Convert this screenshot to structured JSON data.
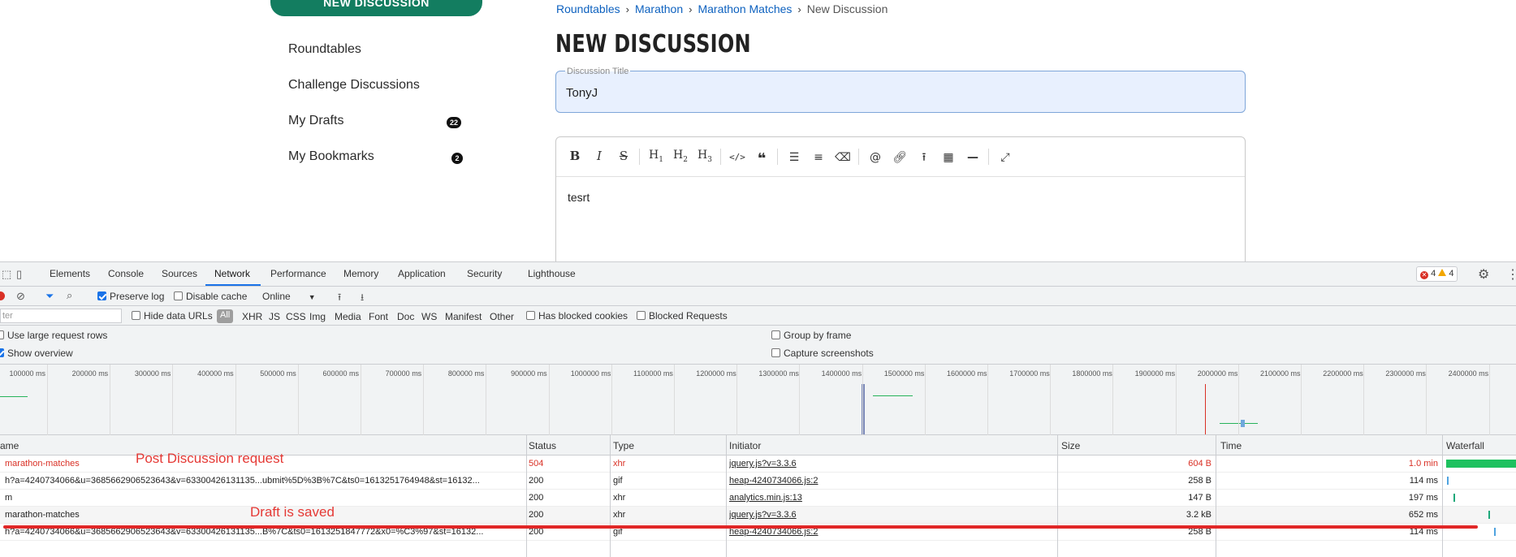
{
  "page": {
    "new_discussion_button": "NEW DISCUSSION",
    "sidebar": [
      {
        "label": "Roundtables",
        "badge": null
      },
      {
        "label": "Challenge Discussions",
        "badge": null
      },
      {
        "label": "My Drafts",
        "badge": "22"
      },
      {
        "label": "My Bookmarks",
        "badge": "2"
      }
    ],
    "breadcrumb": [
      "Roundtables",
      "Marathon",
      "Marathon Matches",
      "New Discussion"
    ],
    "title": "NEW DISCUSSION",
    "discussion_title_label": "Discussion Title",
    "discussion_title_value": "TonyJ",
    "editor_body": "tesrt",
    "editor_toolbar": [
      "bold-icon",
      "italic-icon",
      "strikethrough-icon",
      "heading-1-icon",
      "heading-2-icon",
      "heading-3-icon",
      "code-icon",
      "quote-icon",
      "bullet-list-icon",
      "numbered-list-icon",
      "clear-format-icon",
      "mention-icon",
      "link-icon",
      "upload-icon",
      "table-icon",
      "horizontal-rule-icon",
      "fullscreen-icon"
    ]
  },
  "devtools": {
    "tabs": [
      "Elements",
      "Console",
      "Sources",
      "Network",
      "Performance",
      "Memory",
      "Application",
      "Security",
      "Lighthouse"
    ],
    "active_tab": "Network",
    "errors": "4",
    "warnings": "4",
    "preserve_log": "Preserve log",
    "disable_cache": "Disable cache",
    "throttle": "Online",
    "filter_placeholder": "ter",
    "hide_data_urls": "Hide data URLs",
    "types": [
      "All",
      "XHR",
      "JS",
      "CSS",
      "Img",
      "Media",
      "Font",
      "Doc",
      "WS",
      "Manifest",
      "Other"
    ],
    "has_blocked_cookies": "Has blocked cookies",
    "blocked_requests": "Blocked Requests",
    "use_large_rows": "Use large request rows",
    "show_overview": "Show overview",
    "group_by_frame": "Group by frame",
    "capture_screenshots": "Capture screenshots",
    "overview_ticks": [
      "100000 ms",
      "200000 ms",
      "300000 ms",
      "400000 ms",
      "500000 ms",
      "600000 ms",
      "700000 ms",
      "800000 ms",
      "900000 ms",
      "1000000 ms",
      "1100000 ms",
      "1200000 ms",
      "1300000 ms",
      "1400000 ms",
      "1500000 ms",
      "1600000 ms",
      "1700000 ms",
      "1800000 ms",
      "1900000 ms",
      "2000000 ms",
      "2100000 ms",
      "2200000 ms",
      "2300000 ms",
      "2400000 ms"
    ],
    "columns": [
      "ame",
      "Status",
      "Type",
      "Initiator",
      "Size",
      "Time",
      "Waterfall"
    ],
    "rows": [
      {
        "name": "marathon-matches",
        "status": "504",
        "type": "xhr",
        "initiator": "jquery.js?v=3.3.6",
        "size": "604 B",
        "time": "1.0 min",
        "error": true
      },
      {
        "name": "h?a=4240734066&u=3685662906523643&v=63300426131135...ubmit%5D%3B%7C&ts0=1613251764948&st=16132...",
        "status": "200",
        "type": "gif",
        "initiator": "heap-4240734066.js:2",
        "size": "258 B",
        "time": "114 ms",
        "error": false
      },
      {
        "name": "m",
        "status": "200",
        "type": "xhr",
        "initiator": "analytics.min.js:13",
        "size": "147 B",
        "time": "197 ms",
        "error": false
      },
      {
        "name": "marathon-matches",
        "status": "200",
        "type": "xhr",
        "initiator": "jquery.js?v=3.3.6",
        "size": "3.2 kB",
        "time": "652 ms",
        "error": false
      },
      {
        "name": "h?a=4240734066&u=3685662906523643&v=63300426131135...B%7C&ts0=1613251847772&x0=%C3%97&st=16132...",
        "status": "200",
        "type": "gif",
        "initiator": "heap-4240734066.js:2",
        "size": "258 B",
        "time": "114 ms",
        "error": false
      }
    ]
  },
  "annotations": {
    "post_request": "Post Discussion request",
    "draft_saved": "Draft is saved"
  },
  "colors": {
    "brand_green": "#137d60",
    "link_blue": "#0d61bf",
    "error_red": "#d93025",
    "annotation_red": "#e53935"
  }
}
